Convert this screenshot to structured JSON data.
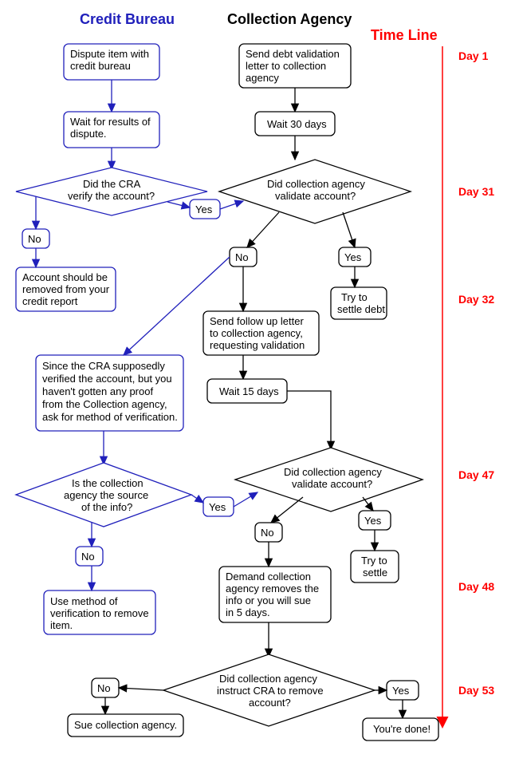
{
  "headers": {
    "credit": "Credit Bureau",
    "collection": "Collection Agency",
    "timeline": "Time Line"
  },
  "timeline": {
    "day1": "Day 1",
    "day31": "Day 31",
    "day32": "Day 32",
    "day47": "Day 47",
    "day48": "Day 48",
    "day53": "Day 53"
  },
  "blue": {
    "dispute": {
      "l1": "Dispute item with",
      "l2": "credit bureau"
    },
    "wait": {
      "l1": "Wait for results of",
      "l2": "dispute."
    },
    "verify": {
      "l1": "Did the CRA",
      "l2": "verify the account?"
    },
    "yes1": "Yes",
    "no1": "No",
    "removed": {
      "l1": "Account should be",
      "l2": "removed from your",
      "l3": "credit report"
    },
    "since": {
      "l1": "Since the CRA supposedly",
      "l2": "verified the account, but you",
      "l3": "haven't gotten any proof",
      "l4": "from the Collection agency,",
      "l5": "ask for method of verification."
    },
    "source": {
      "l1": "Is the collection",
      "l2": "agency the source",
      "l3": "of the info?"
    },
    "yes2": "Yes",
    "no2": "No",
    "method": {
      "l1": "Use method of",
      "l2": "verification to remove",
      "l3": "item."
    }
  },
  "black": {
    "send": {
      "l1": "Send debt validation",
      "l2": "letter to collection",
      "l3": "agency"
    },
    "wait30": "Wait 30 days",
    "validate1": {
      "l1": "Did collection agency",
      "l2": "validate account?"
    },
    "no1": "No",
    "yes1": "Yes",
    "settle1": {
      "l1": "Try to",
      "l2": "settle debt"
    },
    "followup": {
      "l1": "Send follow up letter",
      "l2": "to collection agency,",
      "l3": "requesting validation"
    },
    "wait15": "Wait 15 days",
    "validate2": {
      "l1": "Did collection agency",
      "l2": "validate account?"
    },
    "no2": "No",
    "yes2": "Yes",
    "settle2": {
      "l1": "Try to",
      "l2": "settle"
    },
    "demand": {
      "l1": "Demand collection",
      "l2": "agency removes the",
      "l3": "info or you will sue",
      "l4": "in 5 days."
    },
    "instruct": {
      "l1": "Did collection agency",
      "l2": "instruct CRA to remove",
      "l3": "account?"
    },
    "no3": "No",
    "yes3": "Yes",
    "sue": "Sue collection agency.",
    "done": "You're done!"
  }
}
